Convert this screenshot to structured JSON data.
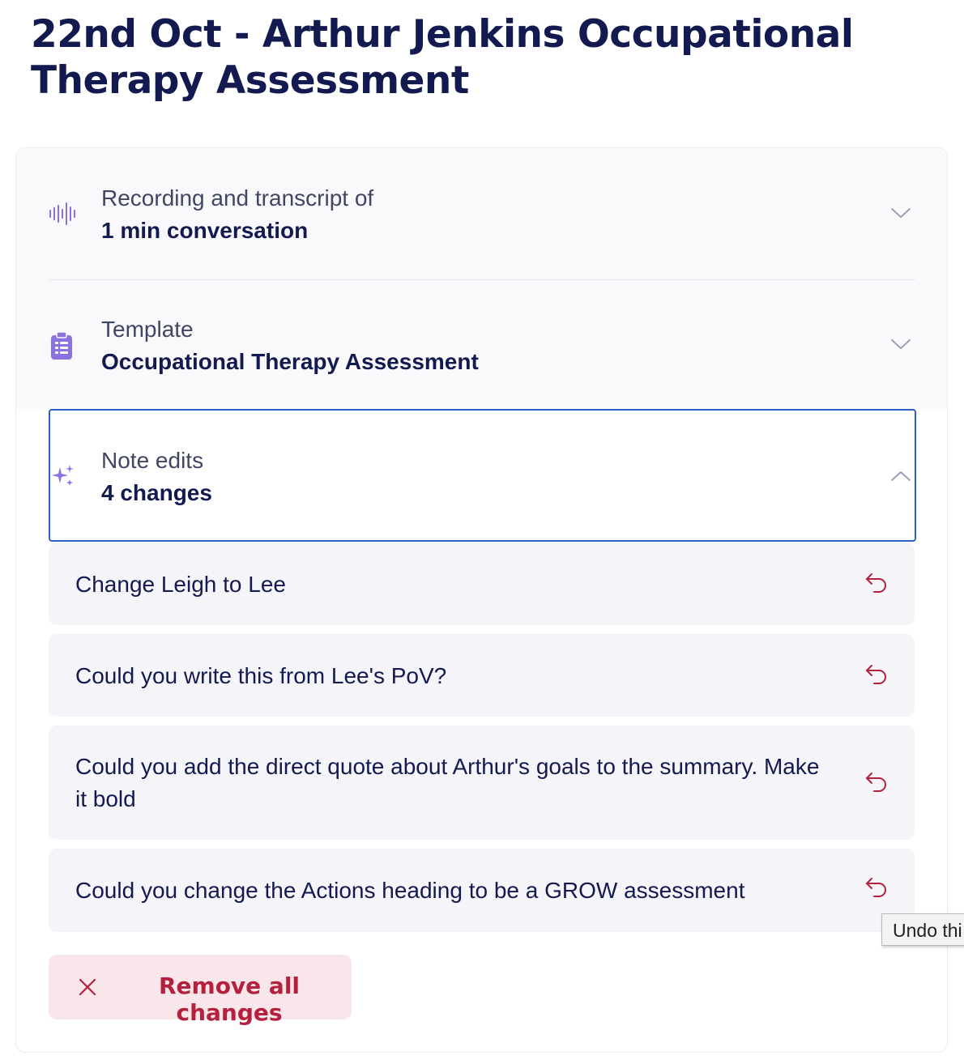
{
  "page": {
    "title": "22nd Oct - Arthur Jenkins Occupational Therapy Assessment"
  },
  "sections": {
    "recording": {
      "label": "Recording and transcript of",
      "value": "1 min conversation",
      "icon": "waveform-icon",
      "expanded": false
    },
    "template": {
      "label": "Template",
      "value": "Occupational Therapy Assessment",
      "icon": "clipboard-list-icon",
      "expanded": false
    },
    "note_edits": {
      "label": "Note edits",
      "value": "4 changes",
      "icon": "sparkles-icon",
      "expanded": true
    }
  },
  "edits": [
    {
      "text": "Change Leigh to Lee"
    },
    {
      "text": "Could you write this from Lee's PoV?"
    },
    {
      "text": "Could you add the direct quote about Arthur's goals to the summary. Make it bold"
    },
    {
      "text": "Could you change the Actions heading to be a GROW assessment"
    }
  ],
  "actions": {
    "remove_all_label": "Remove all changes"
  },
  "tooltip": {
    "text": "Undo thi"
  },
  "colors": {
    "title": "#131a4f",
    "accent_purple": "#8b72e0",
    "focus_border": "#2c5fc4",
    "undo_red": "#b3213e",
    "remove_bg": "#f9e6ea"
  }
}
